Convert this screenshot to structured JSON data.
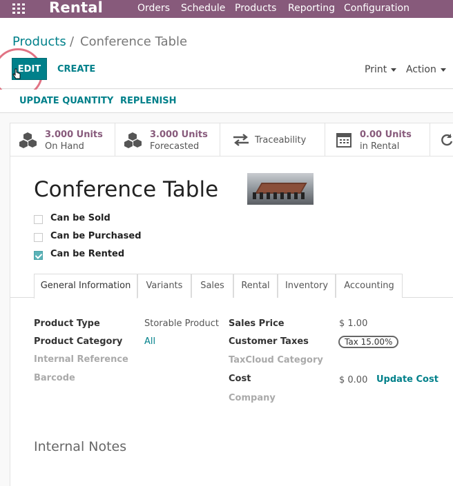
{
  "app": {
    "name": "Rental"
  },
  "nav": [
    "Orders",
    "Schedule",
    "Products",
    "Reporting",
    "Configuration"
  ],
  "breadcrumb": {
    "parent": "Products",
    "separator": "/",
    "current": "Conference Table"
  },
  "toolbar": {
    "edit_label": "EDIT",
    "create_label": "CREATE",
    "print_label": "Print",
    "action_label": "Action"
  },
  "header_buttons": [
    "UPDATE QUANTITY",
    "REPLENISH"
  ],
  "stats": [
    {
      "line1": "3.000 Units",
      "line2": "On Hand",
      "icon": "cubes-icon"
    },
    {
      "line1": "3.000 Units",
      "line2": "Forecasted",
      "icon": "cubes-icon"
    },
    {
      "label": "Traceability",
      "icon": "exchange-icon"
    },
    {
      "line1": "0.00 Units",
      "line2": "in Rental",
      "icon": "calendar-icon"
    }
  ],
  "product": {
    "name": "Conference Table",
    "checkboxes": [
      {
        "label": "Can be Sold",
        "checked": false
      },
      {
        "label": "Can be Purchased",
        "checked": false
      },
      {
        "label": "Can be Rented",
        "checked": true
      }
    ]
  },
  "tabs": [
    "General Information",
    "Variants",
    "Sales",
    "Rental",
    "Inventory",
    "Accounting"
  ],
  "general": {
    "product_type_label": "Product Type",
    "product_type_value": "Storable Product",
    "product_category_label": "Product Category",
    "product_category_value": "All",
    "internal_reference_label": "Internal Reference",
    "barcode_label": "Barcode",
    "sales_price_label": "Sales Price",
    "sales_price_value": "$ 1.00",
    "customer_taxes_label": "Customer Taxes",
    "customer_taxes_value": "Tax 15.00%",
    "taxcloud_label": "TaxCloud Category",
    "cost_label": "Cost",
    "cost_value": "$ 0.00",
    "update_cost_label": "Update Cost",
    "company_label": "Company"
  },
  "notes_title": "Internal Notes",
  "colors": {
    "brand": "#875a7b",
    "accent": "#00808a"
  }
}
